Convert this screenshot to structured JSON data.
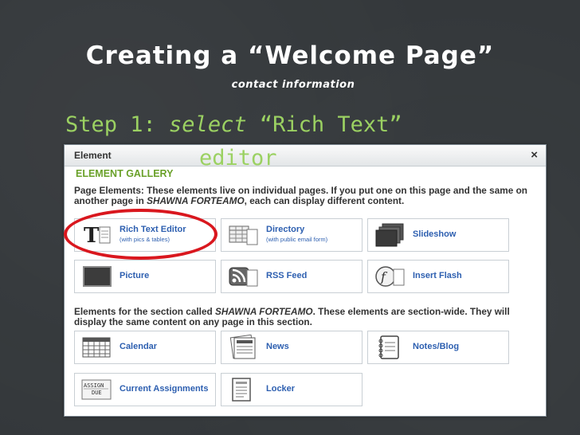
{
  "slide": {
    "title": "Creating a “Welcome Page”",
    "subtitle": "contact information",
    "step_prefix": "Step 1: ",
    "step_select": "select",
    "step_rest": " “Rich Text”",
    "step_line2": "editor"
  },
  "dialog": {
    "title": "Element",
    "close": "×",
    "gallery_heading": "ELEMENT GALLERY",
    "page_desc_a": "Page Elements: These elements live on individual pages. If you put one on this page and the same on another page in ",
    "page_desc_em": "SHAWNA FORTEAMO",
    "page_desc_b": ", each can display different content.",
    "section_desc_a": "Elements for the section called ",
    "section_desc_em": "SHAWNA FORTEAMO",
    "section_desc_b": ". These elements are section-wide. They will display the same content on any page in this section.",
    "page_elements": [
      {
        "label": "Rich Text Editor",
        "sub": "(with pics & tables)",
        "icon": "rich-text-icon"
      },
      {
        "label": "Directory",
        "sub": "(with public email form)",
        "icon": "directory-icon"
      },
      {
        "label": "Slideshow",
        "sub": "",
        "icon": "slideshow-icon"
      },
      {
        "label": "Picture",
        "sub": "",
        "icon": "picture-icon"
      },
      {
        "label": "RSS Feed",
        "sub": "",
        "icon": "rss-icon"
      },
      {
        "label": "Insert Flash",
        "sub": "",
        "icon": "flash-icon"
      }
    ],
    "section_elements": [
      {
        "label": "Calendar",
        "icon": "calendar-icon"
      },
      {
        "label": "News",
        "icon": "news-icon"
      },
      {
        "label": "Notes/Blog",
        "icon": "notebook-icon"
      },
      {
        "label": "Current Assignments",
        "icon": "assignment-icon",
        "icon_text": [
          "ASSIGN",
          "DUE"
        ]
      },
      {
        "label": "Locker",
        "icon": "locker-icon"
      }
    ]
  },
  "colors": {
    "background": "#34383b",
    "step_green": "#9bd162",
    "gallery_green": "#6aa12a",
    "link_blue": "#2d5fb0",
    "highlight_red": "#d9171e"
  }
}
